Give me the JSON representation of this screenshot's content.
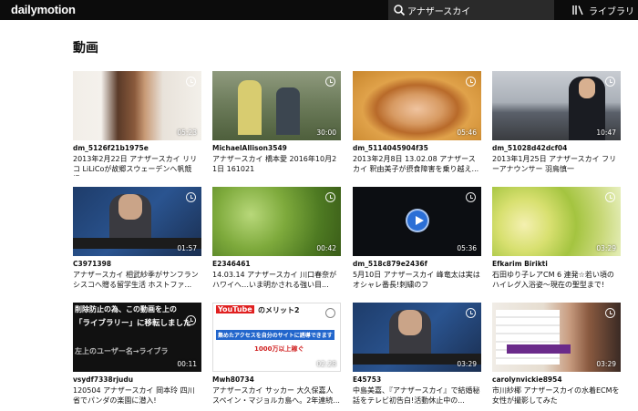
{
  "header": {
    "logo": "dailymotion",
    "search_value": "アナザースカイ",
    "library_label": "ライブラリ"
  },
  "section": {
    "title": "動画"
  },
  "videos": [
    {
      "owner": "dm_5126f21b1975e",
      "title": "2013年2月22日 アナザースカイ リリコ LiLiCoが故郷スウェーデンへ帆競播...",
      "duration": "05:23"
    },
    {
      "owner": "MichaelAllison3549",
      "title": "アナザースカイ 橋本愛 2016年10月21日 161021",
      "duration": "30:00"
    },
    {
      "owner": "dm_5114045904f35",
      "title": "2013年2月8日 13.02.08 アナザースカイ 釈由美子が摂食障害を乗り越え...",
      "duration": "05:46"
    },
    {
      "owner": "dm_51028d42dcf04",
      "title": "2013年1月25日 アナザースカイ フリーアナウンサー 羽鳥慎一",
      "duration": "10:47"
    },
    {
      "owner": "C3971398",
      "title": "アナザースカイ 相武紗季がサンフランシスコへ贈る留学生活 ホストファ...",
      "duration": "01:57"
    },
    {
      "owner": "E2346461",
      "title": "14.03.14 アナザースカイ 川口春奈がハワイへ…いま明かされる強い目...",
      "duration": "00:42"
    },
    {
      "owner": "dm_518c879e2436f",
      "title": "5月10日 アナザースカイ 峰竜太は実はオシャレ番長!刺繍のフ",
      "duration": "05:36"
    },
    {
      "owner": "Efkarim Birikti",
      "title": "石田ゆり子レアCM 6 連発☆若い頃のハイレグ入浴姿〜現在の聖型まで!",
      "duration": "03:29"
    },
    {
      "owner": "vsydf7338rjudu",
      "title": "120504 アナザースカイ 岡本玲 四川省でパンダの楽園に潜入!",
      "duration": "00:11",
      "overlay": [
        "削除防止の為、この動画を上の",
        "「ライブラリー」に移転しました",
        "左上のユーザー名→ライブラ"
      ]
    },
    {
      "owner": "Mwh80734",
      "title": "アナザースカイ サッカー 大久保嘉人 スペイン・マジョルカ島へ。2年連続...",
      "duration": "02:28",
      "overlay": [
        "YouTube",
        "のメリット2",
        "集めたアクセスを自分のサイトに誘導できます",
        "1000万以上稼ぐ"
      ]
    },
    {
      "owner": "E45753",
      "title": "中島美嘉、『アナザースカイ』で結婚秘話をテレビ初告白!活動休止中の...",
      "duration": "03:29"
    },
    {
      "owner": "carolynvickie8954",
      "title": "市川紗椰 アナザースカイの水着ECMを女性が撮影してみた",
      "duration": "03:29"
    }
  ],
  "colors": {
    "topbar": "#0c0c0c",
    "search_bg": "#2a2a2a",
    "play_accent": "#2b6fd6"
  }
}
